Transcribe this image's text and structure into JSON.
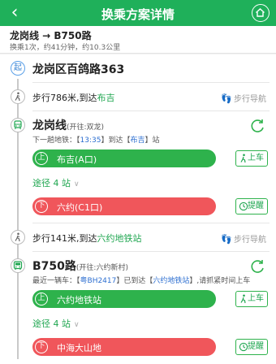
{
  "header": {
    "back_icon": "back-chevron-icon",
    "title": "换乘方案详情",
    "home_icon": "home-icon"
  },
  "summary": {
    "route": "龙岗线 → B750路",
    "detail": "换乘1次，约41分钟，约10.3公里"
  },
  "start": {
    "badge": "起",
    "name": "龙岗区百鸽路363"
  },
  "walk1": {
    "prefix": "步行786米,到达",
    "dest": "布吉",
    "nav_label": "步行导航"
  },
  "line1": {
    "name": "龙岗线",
    "direction": "(开往:双龙)",
    "next_prefix": "下一趟地铁：【",
    "next_time": "13:35",
    "next_mid": "】到达【",
    "next_station": "布吉",
    "next_suffix": "】站",
    "board_badge": "上",
    "board_station": "布吉(A口)",
    "board_action": "上车",
    "via": "途径 4 站",
    "alight_badge": "下",
    "alight_station": "六约(C1口)",
    "alight_action": "提醒"
  },
  "walk2": {
    "prefix": "步行141米,到达",
    "dest": "六约地铁站",
    "nav_label": "步行导航"
  },
  "line2": {
    "name": "B750路",
    "direction": "(开往:六约新村)",
    "recent_prefix": "最近一辆车：【",
    "plate": "粤BH2417",
    "recent_mid": "】已到达【",
    "recent_station": "六约地铁站",
    "recent_suffix": "】,请抓紧时间上车",
    "board_badge": "上",
    "board_station": "六约地铁站",
    "board_action": "上车",
    "via": "途径 4 站",
    "alight_badge": "下",
    "alight_station": "中海大山地",
    "alight_action": "提醒"
  },
  "colors": {
    "brand_green": "#1fb05a",
    "board_green": "#2eb24c",
    "alight_red": "#f0565b",
    "link_blue": "#2d6fd1"
  }
}
